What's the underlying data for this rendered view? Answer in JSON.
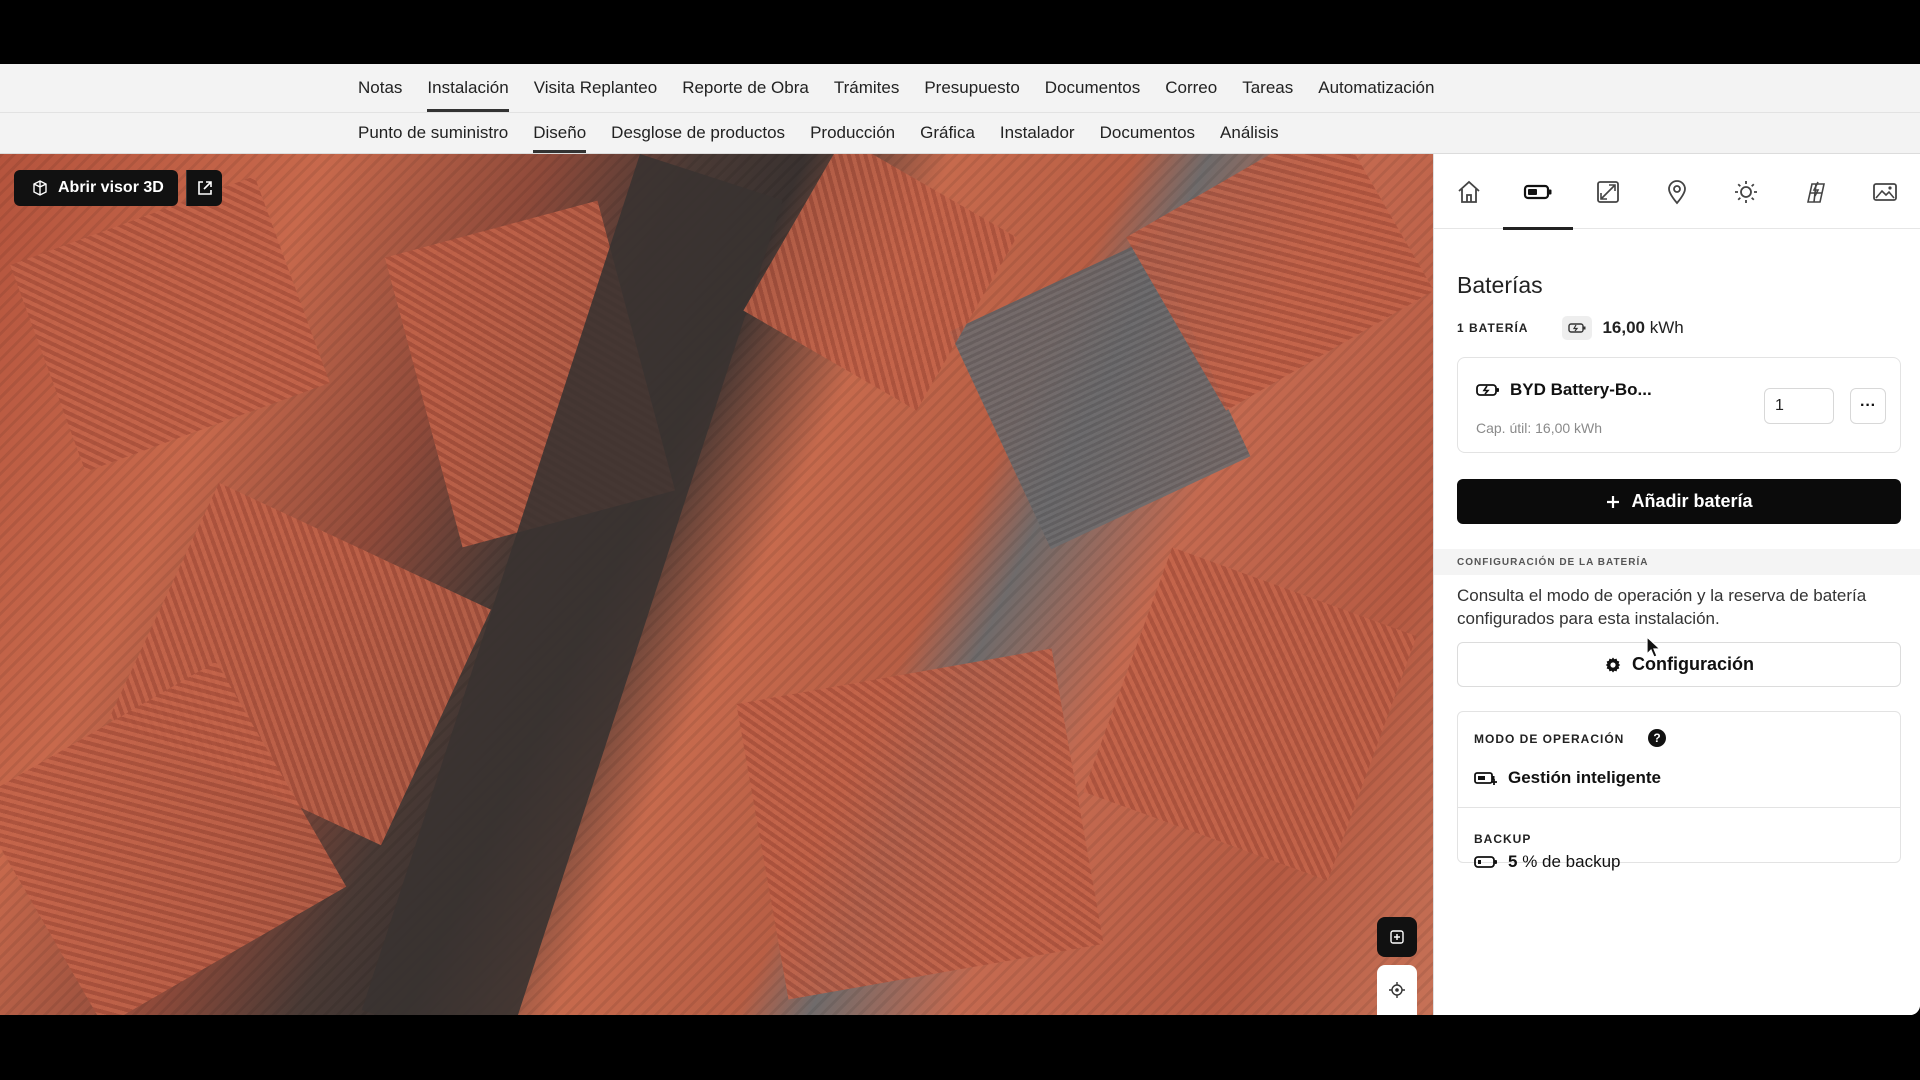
{
  "tabs_primary": [
    "Notas",
    "Instalación",
    "Visita Replanteo",
    "Reporte de Obra",
    "Trámites",
    "Presupuesto",
    "Documentos",
    "Correo",
    "Tareas",
    "Automatización"
  ],
  "tabs_primary_active": "Instalación",
  "tabs_secondary": [
    "Punto de suministro",
    "Diseño",
    "Desglose de productos",
    "Producción",
    "Gráfica",
    "Instalador",
    "Documentos",
    "Análisis"
  ],
  "tabs_secondary_active": "Diseño",
  "map": {
    "open_3d_label": "Abrir visor 3D"
  },
  "panel": {
    "icon_tabs": [
      "home-icon",
      "battery-icon",
      "panel-layout-icon",
      "location-pin-icon",
      "sun-icon",
      "solar-roof-icon",
      "image-icon"
    ],
    "active_icon_tab": "battery-icon",
    "title": "Baterías",
    "battery_count_label": "1 BATERÍA",
    "total_capacity_value": "16,00",
    "total_capacity_unit": "kWh",
    "battery_card": {
      "name": "BYD Battery-Bo...",
      "capacity_text": "Cap. útil: 16,00 kWh",
      "quantity": "1",
      "more_label": "···"
    },
    "add_button_label": "Añadir batería",
    "config_section_label": "CONFIGURACIÓN DE LA BATERÍA",
    "config_description": "Consulta el modo de operación y la reserva de batería configurados para esta instalación.",
    "config_button_label": "Configuración",
    "operation_mode_label": "MODO DE OPERACIÓN",
    "operation_mode_help": "?",
    "operation_mode_value": "Gestión inteligente",
    "backup_label": "BACKUP",
    "backup_value_bold": "5",
    "backup_value_rest": "% de backup"
  }
}
